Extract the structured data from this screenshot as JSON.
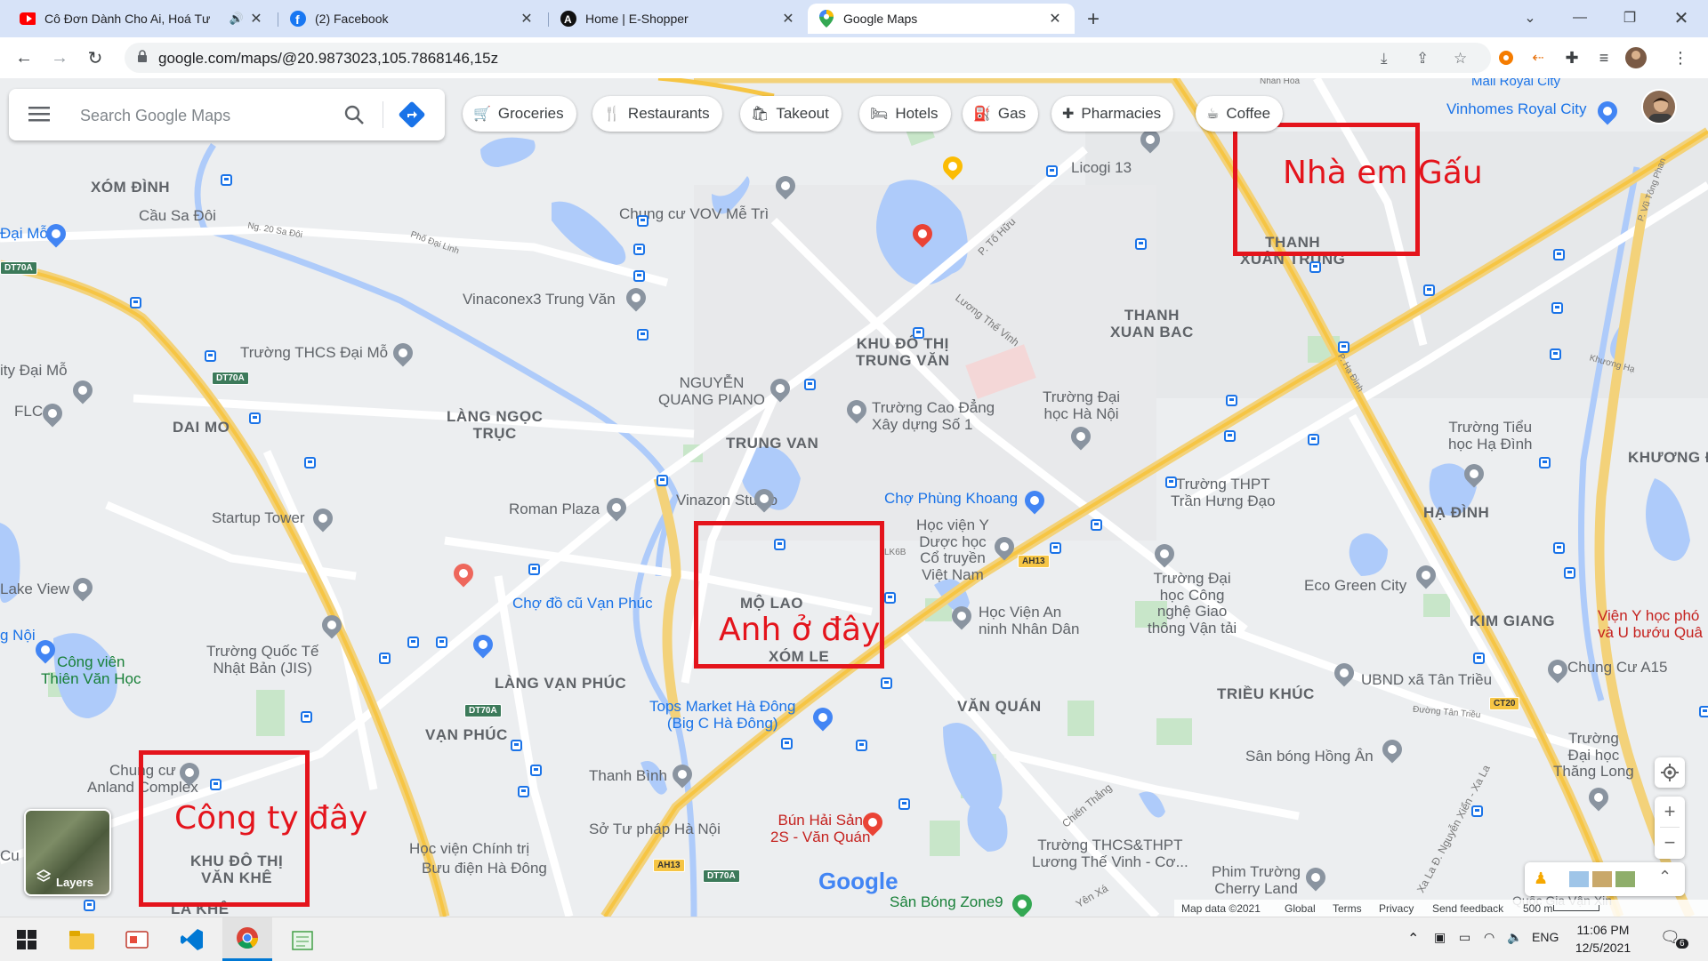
{
  "browser": {
    "tabs": [
      {
        "title": "Cô Đơn Dành Cho Ai, Hoá Tư",
        "icon": "youtube-icon",
        "active": false
      },
      {
        "title": "(2) Facebook",
        "icon": "facebook-icon",
        "active": false
      },
      {
        "title": "Home | E-Shopper",
        "icon": "a-logo-icon",
        "active": false
      },
      {
        "title": "Google Maps",
        "icon": "google-maps-icon",
        "active": true
      }
    ],
    "url": "google.com/maps/@20.9873023,105.7868146,15z"
  },
  "maps": {
    "search_placeholder": "Search Google Maps",
    "chips": [
      "Groceries",
      "Restaurants",
      "Takeout",
      "Hotels",
      "Gas",
      "Pharmacies",
      "Coffee"
    ],
    "layers_label": "Layers",
    "footer": {
      "map_data": "Map data ©2021",
      "global": "Global",
      "terms": "Terms",
      "privacy": "Privacy",
      "feedback": "Send feedback",
      "scale": "500 m"
    },
    "logo": "Google"
  },
  "map_labels": {
    "xom_dinh": "XÓM ĐÌNH",
    "cau_sa_doi": "Cầu Sa Đôi",
    "dai_mo_left": "Đại Mỗ",
    "ity_dai_mo": "ity Đại Mỗ",
    "flc": "FLC",
    "dai_mo": "DAI MO",
    "lake_view": "Lake View",
    "ng_noi": "g Nội",
    "cong_vien": "Công viên\nThiên Văn Học",
    "truong_quoc_te": "Trường Quốc Tế\nNhật Bản (JIS)",
    "chung_cu_anland": "Chung cư\nAnland Complex",
    "khu_do_thi_van_khe": "KHU ĐÔ THỊ\nVĂN KHÊ",
    "la_khe": "LA KHÊ",
    "cu": "Cu",
    "vinaconex3": "Vinaconex3 Trung Văn",
    "truong_thcs_dai_mo": "Trường THCS Đại Mỗ",
    "chung_cu_vov": "Chung cư VOV Mễ Trì",
    "lang_ngoc_truc": "LÀNG NGỌC\nTRỤC",
    "nguyen_quang_piano": "NGUYỄN\nQUANG PIANO",
    "trung_van": "TRUNG VAN",
    "khu_do_thi_trung_van": "KHU ĐÔ THỊ\nTRUNG VĂN",
    "truong_cao_dang": "Trường Cao Đẳng\nXây dựng Số 1",
    "startup_tower": "Startup Tower",
    "roman_plaza": "Roman Plaza",
    "vinazon_studio": "Vinazon Studio",
    "cho_do_cu": "Chợ đồ cũ Vạn Phúc",
    "lang_van_phuc": "LÀNG VẠN PHÚC",
    "van_phuc": "VẠN PHÚC",
    "thanh_binh": "Thanh Bình",
    "hoc_vien_chinh_tri": "Học viện Chính trị",
    "buu_dien": "Bưu điện Hà Đông",
    "so_tu_phap": "Sở Tư pháp Hà Nội",
    "mo_lao": "MỘ LAO",
    "xom_le": "XÓM LE",
    "tops_market": "Tops Market Hà Đông\n(Big C Hà Đông)",
    "bun_hai_san": "Bún Hải Sản\n2S - Văn Quán",
    "san_bong_zone9": "Sân Bóng Zone9",
    "licogi13": "Licogi 13",
    "thanh_xuan_bac": "THANH\nXUAN BAC",
    "thanh_xuan_trung": "THANH\nXUÂN TRUNG",
    "truong_dai_hoc_ha_noi": "Trường Đại\nhọc Hà Nội",
    "cho_phung_khoang": "Chợ Phùng Khoang",
    "hoc_vien_y_duoc": "Học viện Y\nDược học\nCổ truyền\nViệt Nam",
    "hoc_vien_an_ninh": "Học Viện An\nninh Nhân Dân",
    "truong_thpt_tran_hung_dao": "Trường THPT\nTrần Hưng Đạo",
    "truong_dai_hoc_cong_nghe": "Trường Đại\nhọc Công\nnghệ Giao\nthông Vận tải",
    "van_quan": "VĂN QUÁN",
    "trieu_khuc": "TRIỀU KHÚC",
    "truong_thcs_luong_the_vinh": "Trường THCS&THPT\nLương Thế Vinh - Cơ...",
    "phim_truong": "Phim Trường\nCherry Land",
    "san_bong_hong_an": "Sân bóng Hồng Ân",
    "ubnd_tan_trieu": "UBND xã Tân Triều",
    "eco_green_city": "Eco Green City",
    "kim_giang": "KIM GIANG",
    "ha_dinh": "HẠ ĐÌNH",
    "khuong_d": "KHƯƠNG Đ",
    "truong_tieu_hoc_ha_dinh": "Trường Tiểu\nhọc Hạ Đình",
    "chung_cu_a15": "Chung Cư A15",
    "truong_dai_hoc_thang_long": "Trường\nĐại học\nThăng Long",
    "vien_y_hoc": "Viện Y học phó\nvà U bướu Quâ",
    "vinhomes_royal_city": "Vinhomes Royal City",
    "mall_royal_city": "Mall Royal City",
    "quoc_gia": "Quốc Gia Vận Xin",
    "nhan_hoa": "Nhân Hòa",
    "chien_thang": "Chiến Thắng",
    "yen_xa": "Yên Xá"
  },
  "road_labels": {
    "dt70a": "DT70A",
    "ah13": "AH13",
    "ct20": "CT20",
    "lk6b": "LK6B",
    "ng20_sa_doi": "Ng. 20 Sa Đôi",
    "pho_dai_linh": "Phố Đại Linh",
    "p_to_huu": "P. Tố Hữu",
    "luong_the_vinh": "Lương Thế Vinh",
    "p_ho_dinh": "P. Hạ Đình",
    "duong_tan_trieu": "Đường Tân Triều",
    "xa_la": "Xa La Đ. Nguyễn Xiển - Xa La",
    "p_vu_tong_phan": "P. Vũ Tông Phan",
    "khuong_ha": "Khương Hạ"
  },
  "annotations": {
    "nha_em": "Nhà em Gấu",
    "anh_o_day": "Anh ở đây",
    "cong_ty": "Công ty đây"
  },
  "taskbar": {
    "lang": "ENG",
    "time": "11:06 PM",
    "date": "12/5/2021",
    "notif_count": "6"
  },
  "colors": {
    "annotation_red": "#e4141c",
    "highway_yellow": "#f6c544",
    "water_blue": "#aecbfa",
    "park_green": "#c3e6cb",
    "transit_blue": "#1a73e8"
  }
}
